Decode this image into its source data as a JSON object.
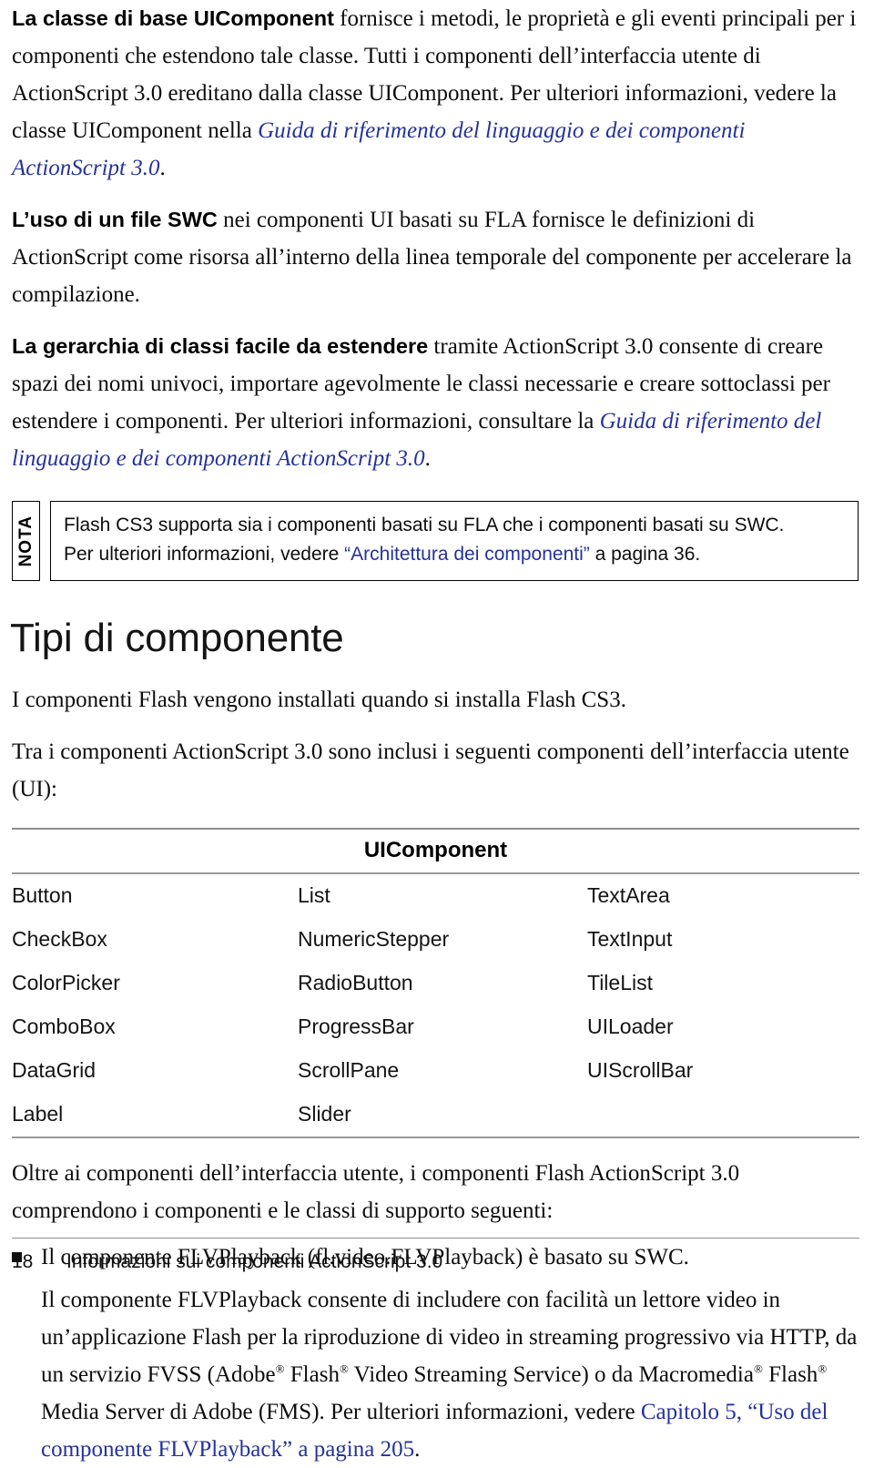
{
  "document": {
    "language": "it",
    "link_color": "#25329b",
    "page_number": "18",
    "footer_title": "Informazioni sui componenti ActionScript 3.0"
  },
  "paragraphs": {
    "p1": {
      "lead": "La classe di base UIComponent",
      "body_a": " fornisce i metodi, le proprietà e gli eventi principali per i componenti che estendono tale classe. Tutti i componenti dell’interfaccia utente di ActionScript 3.0 ereditano dalla classe UIComponent. Per ulteriori informazioni, vedere la classe UIComponent nella ",
      "link": "Guida di riferimento del linguaggio e dei componenti ActionScript 3.0",
      "body_b": "."
    },
    "p2": {
      "lead": "L’uso di un file SWC",
      "body": " nei componenti UI basati su FLA fornisce le definizioni di ActionScript come risorsa all’interno della linea temporale del componente per accelerare la compilazione."
    },
    "p3": {
      "lead": "La gerarchia di classi facile da estendere",
      "body_a": " tramite ActionScript 3.0 consente di creare spazi dei nomi univoci, importare agevolmente le classi necessarie e creare sottoclassi per estendere i componenti. Per ulteriori informazioni, consultare la ",
      "link": "Guida di riferimento del linguaggio e dei componenti ActionScript 3.0",
      "body_b": "."
    },
    "intro_1": "I componenti Flash vengono installati quando si installa Flash CS3.",
    "intro_2": "Tra i componenti ActionScript 3.0 sono inclusi i seguenti componenti dell’interfaccia utente (UI):",
    "after_table_1": "Oltre ai componenti dell’interfaccia utente, i componenti Flash ActionScript 3.0 comprendono i componenti e le classi di supporto seguenti:"
  },
  "note": {
    "label": "NOTA",
    "line1": "Flash CS3 supporta sia i componenti basati su FLA che i componenti basati su SWC.",
    "line2_before": "Per ulteriori informazioni, vedere ",
    "line2_link": "“Architettura dei componenti”",
    "line2_after": " a pagina 36."
  },
  "heading": {
    "section_title": "Tipi di componente"
  },
  "table": {
    "header": "UIComponent",
    "rows": [
      [
        "Button",
        "List",
        "TextArea"
      ],
      [
        "CheckBox",
        "NumericStepper",
        "TextInput"
      ],
      [
        "ColorPicker",
        "RadioButton",
        "TileList"
      ],
      [
        "ComboBox",
        "ProgressBar",
        "UILoader"
      ],
      [
        "DataGrid",
        "ScrollPane",
        "UIScrollBar"
      ],
      [
        "Label",
        "Slider",
        ""
      ]
    ]
  },
  "bullets": [
    {
      "marker": "square-bullet",
      "text": "Il componente FLVPlayback (fl.video.FLVPlayback) è basato su SWC."
    }
  ],
  "flv_paragraph": {
    "part1": "Il componente FLVPlayback consente di includere con facilità un lettore video in un’applicazione Flash per la riproduzione di video in streaming progressivo via HTTP, da un servizio FVSS (Adobe",
    "reg1": "®",
    "part2": " Flash",
    "reg2": "®",
    "part3": " Video Streaming Service) o da Macromedia",
    "reg3": "®",
    "part4": " Flash",
    "reg4": "®",
    "part5": " Media Server di Adobe (FMS). Per ulteriori informazioni, vedere ",
    "link": "Capitolo 5, “Uso del componente FLVPlayback” a pagina 205",
    "part6": "."
  }
}
